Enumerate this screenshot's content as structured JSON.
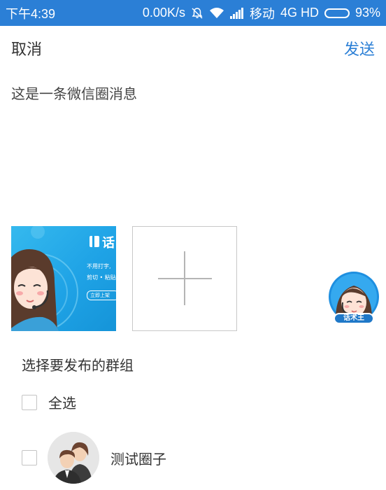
{
  "status_bar": {
    "time": "下午4:39",
    "net_speed": "0.00K/s",
    "carrier": "移动",
    "network": "4G HD",
    "battery_text": "93%",
    "battery_level": 0.93
  },
  "header": {
    "cancel_label": "取消",
    "send_label": "发送"
  },
  "message": {
    "text": "这是一条微信圈消息"
  },
  "attachment": {
    "thumb_brand": "话",
    "thumb_line1": "不用打字,",
    "thumb_line2": "剪切 • 粘贴",
    "thumb_button": "立即上架"
  },
  "assistant": {
    "badge": "话术王"
  },
  "groups": {
    "title": "选择要发布的群组",
    "select_all_label": "全选",
    "items": [
      {
        "name": "测试圈子"
      }
    ]
  },
  "colors": {
    "accent": "#2b7fd6",
    "status_bar": "#2b7fd6"
  }
}
